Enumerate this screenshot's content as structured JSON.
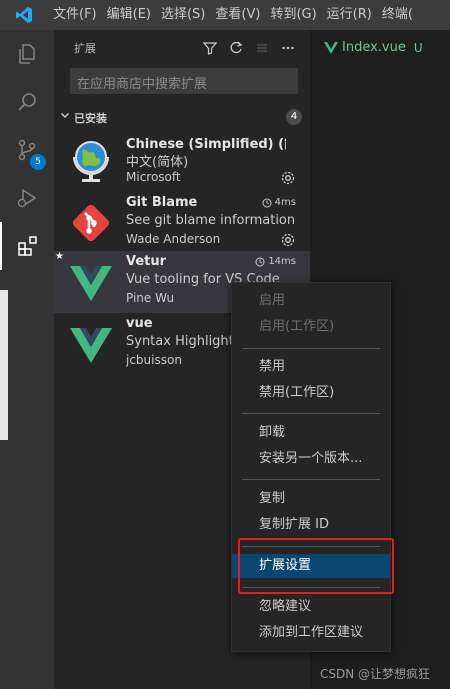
{
  "titlebar": {
    "menus": [
      "文件(F)",
      "编辑(E)",
      "选择(S)",
      "查看(V)",
      "转到(G)",
      "运行(R)",
      "终端("
    ]
  },
  "activity": {
    "scm_badge": "5"
  },
  "sidebar": {
    "title": "扩展",
    "search_placeholder": "在应用商店中搜索扩展",
    "section_label": "已安装",
    "section_count": "4"
  },
  "extensions": [
    {
      "name": "Chinese (Simplified) (简...",
      "desc": "中文(简体)",
      "publisher": "Microsoft",
      "time": ""
    },
    {
      "name": "Git Blame",
      "desc": "See git blame information in...",
      "publisher": "Wade Anderson",
      "time": "4ms"
    },
    {
      "name": "Vetur",
      "desc": "Vue tooling for VS Code",
      "publisher": "Pine Wu",
      "time": "14ms"
    },
    {
      "name": "vue",
      "desc": "Syntax Highlight for Vue.js",
      "publisher": "jcbuisson",
      "time": ""
    }
  ],
  "editor": {
    "tab_name": "Index.vue",
    "tab_status": "U"
  },
  "context_menu": {
    "enable": "启用",
    "enable_workspace": "启用(工作区)",
    "disable": "禁用",
    "disable_workspace": "禁用(工作区)",
    "uninstall": "卸载",
    "install_another": "安装另一个版本...",
    "copy": "复制",
    "copy_id": "复制扩展 ID",
    "settings": "扩展设置",
    "ignore": "忽略建议",
    "add_workspace": "添加到工作区建议"
  },
  "watermark": "CSDN @让梦想疯狂",
  "colors": {
    "accent": "#007acc",
    "highlight": "#094771",
    "vue_green": "#41b883",
    "git_red": "#e8423c",
    "annotation_red": "#e51c23"
  }
}
